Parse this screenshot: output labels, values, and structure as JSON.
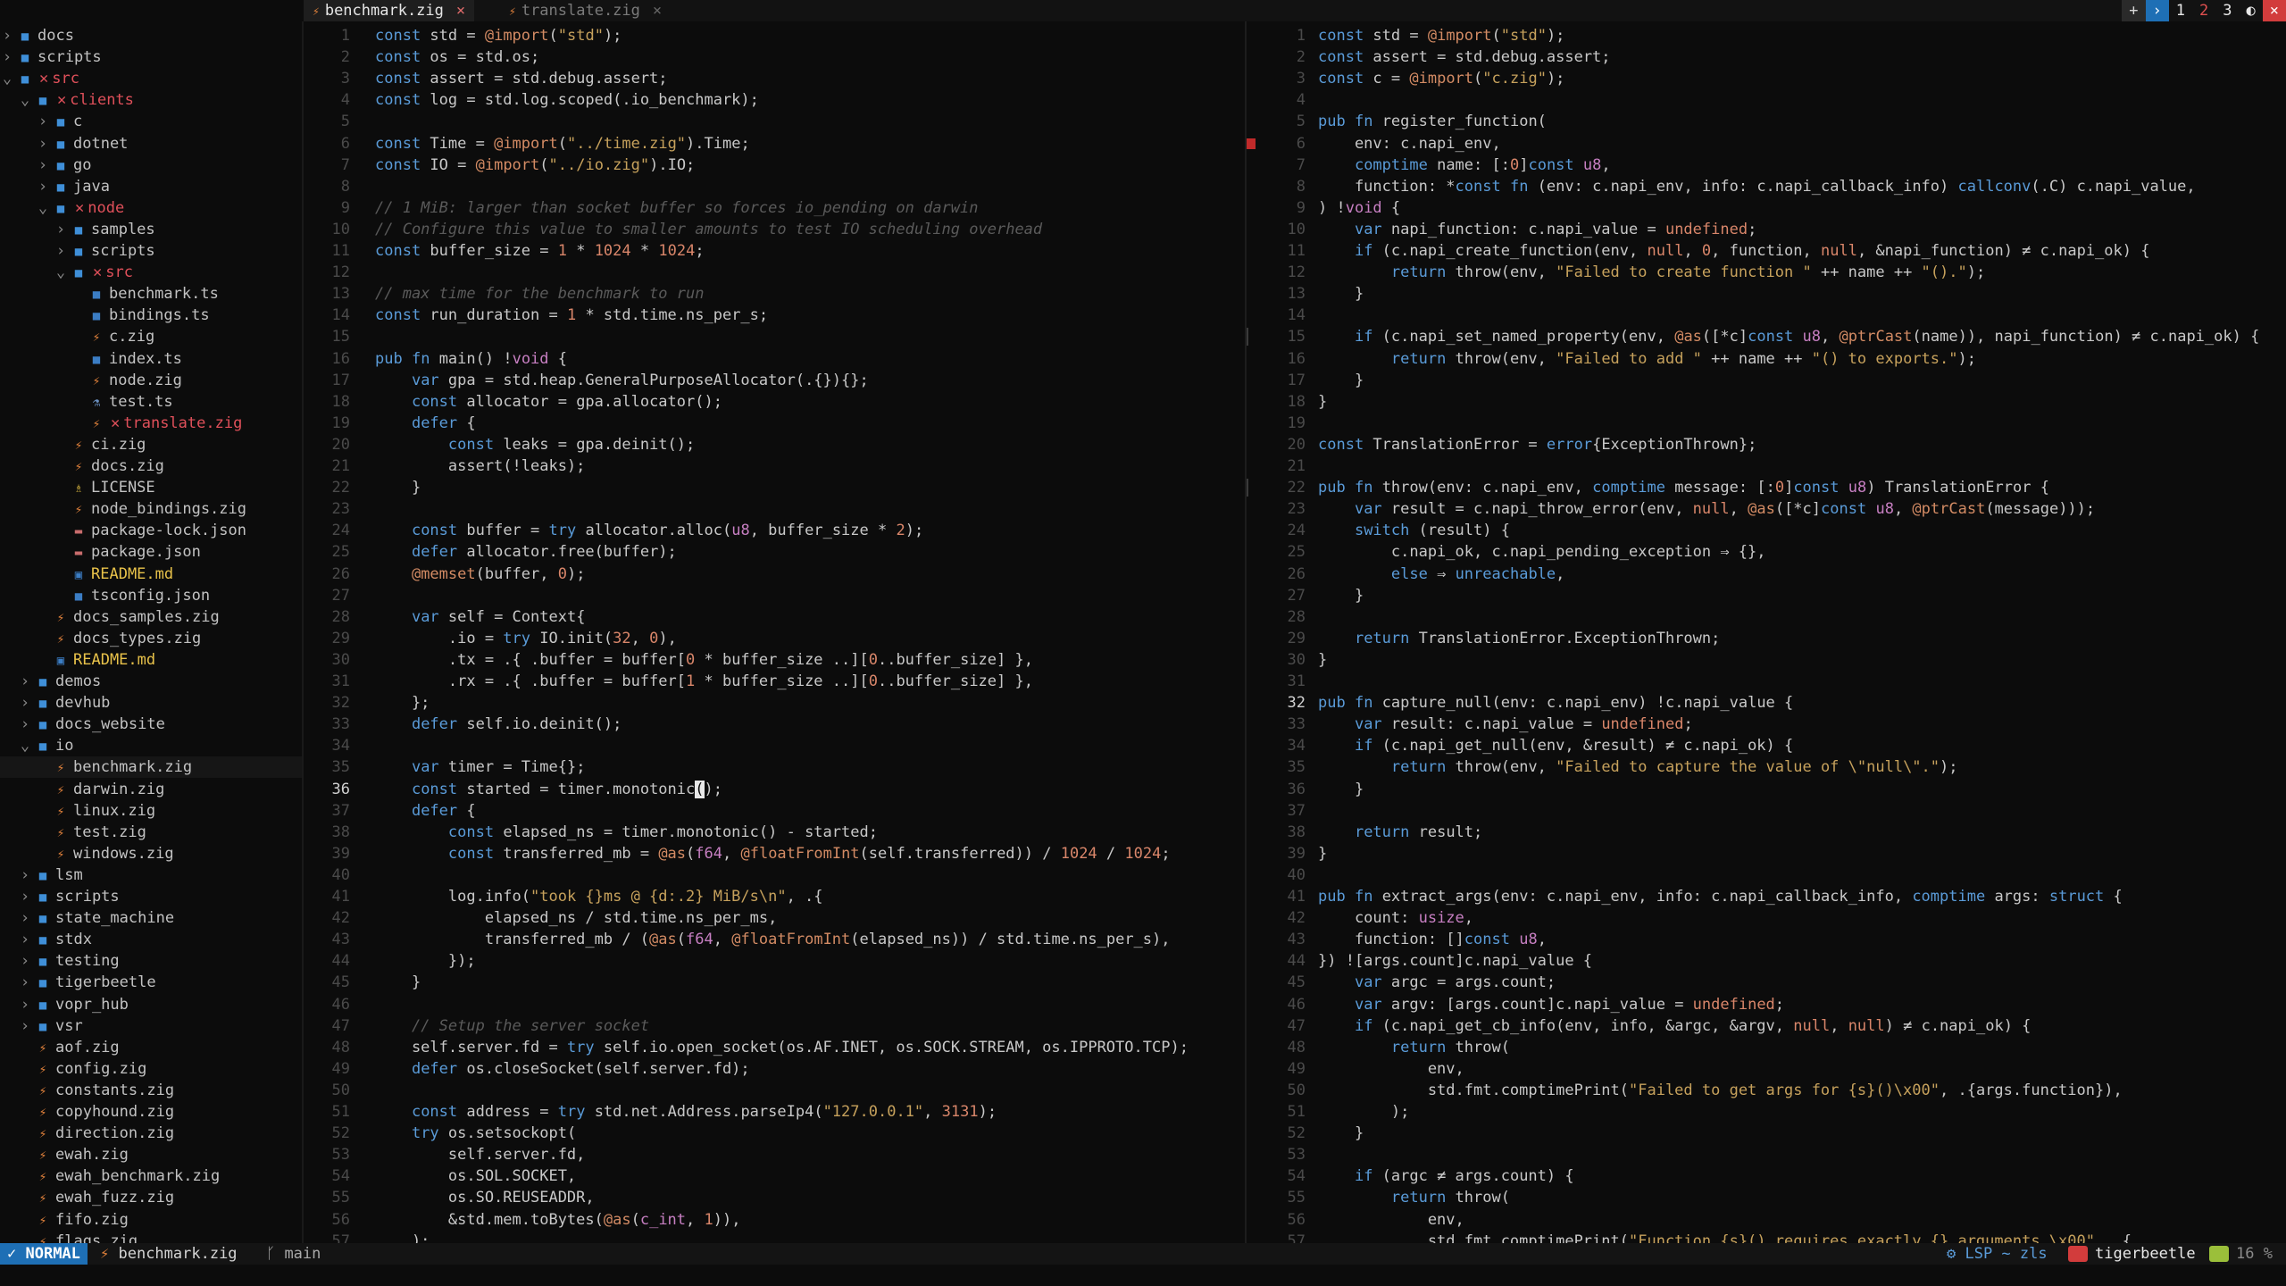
{
  "tabs": [
    {
      "label": "benchmark.zig",
      "active": true,
      "close": "×"
    },
    {
      "label": "translate.zig",
      "active": false,
      "close": "×"
    }
  ],
  "tabbar_right": {
    "plus": "+",
    "arrow": "›",
    "tab1": "1",
    "tab2": "2",
    "tab3": "3",
    "toggle": "◐",
    "close": "×"
  },
  "tree": [
    {
      "name": "docs",
      "type": "folder",
      "depth": 0,
      "chev": "›"
    },
    {
      "name": "scripts",
      "type": "folder",
      "depth": 0,
      "chev": "›"
    },
    {
      "name": "src",
      "type": "folder",
      "depth": 0,
      "chev": "⌄",
      "modified": true
    },
    {
      "name": "clients",
      "type": "folder",
      "depth": 1,
      "chev": "⌄",
      "modified": true
    },
    {
      "name": "c",
      "type": "folder",
      "depth": 2,
      "chev": "›"
    },
    {
      "name": "dotnet",
      "type": "folder",
      "depth": 2,
      "chev": "›"
    },
    {
      "name": "go",
      "type": "folder",
      "depth": 2,
      "chev": "›"
    },
    {
      "name": "java",
      "type": "folder",
      "depth": 2,
      "chev": "›"
    },
    {
      "name": "node",
      "type": "folder",
      "depth": 2,
      "chev": "⌄",
      "modified": true
    },
    {
      "name": "samples",
      "type": "folder",
      "depth": 3,
      "chev": "›"
    },
    {
      "name": "scripts",
      "type": "folder",
      "depth": 3,
      "chev": "›"
    },
    {
      "name": "src",
      "type": "folder",
      "depth": 3,
      "chev": "⌄",
      "modified": true
    },
    {
      "name": "benchmark.ts",
      "type": "ts",
      "depth": 4
    },
    {
      "name": "bindings.ts",
      "type": "ts",
      "depth": 4
    },
    {
      "name": "c.zig",
      "type": "zig",
      "depth": 4
    },
    {
      "name": "index.ts",
      "type": "ts",
      "depth": 4
    },
    {
      "name": "node.zig",
      "type": "zig",
      "depth": 4
    },
    {
      "name": "test.ts",
      "type": "test",
      "depth": 4
    },
    {
      "name": "translate.zig",
      "type": "zig",
      "depth": 4,
      "modified": true
    },
    {
      "name": "ci.zig",
      "type": "zig",
      "depth": 3
    },
    {
      "name": "docs.zig",
      "type": "zig",
      "depth": 3
    },
    {
      "name": "LICENSE",
      "type": "lic",
      "depth": 3
    },
    {
      "name": "node_bindings.zig",
      "type": "zig",
      "depth": 3
    },
    {
      "name": "package-lock.json",
      "type": "json",
      "depth": 3
    },
    {
      "name": "package.json",
      "type": "json",
      "depth": 3
    },
    {
      "name": "README.md",
      "type": "md",
      "depth": 3
    },
    {
      "name": "tsconfig.json",
      "type": "ts",
      "depth": 3
    },
    {
      "name": "docs_samples.zig",
      "type": "zig",
      "depth": 2
    },
    {
      "name": "docs_types.zig",
      "type": "zig",
      "depth": 2
    },
    {
      "name": "README.md",
      "type": "md",
      "depth": 2
    },
    {
      "name": "demos",
      "type": "folder",
      "depth": 1,
      "chev": "›"
    },
    {
      "name": "devhub",
      "type": "folder",
      "depth": 1,
      "chev": "›"
    },
    {
      "name": "docs_website",
      "type": "folder",
      "depth": 1,
      "chev": "›"
    },
    {
      "name": "io",
      "type": "folder",
      "depth": 1,
      "chev": "⌄",
      "open_mod": true
    },
    {
      "name": "benchmark.zig",
      "type": "zig",
      "depth": 2,
      "selected": true
    },
    {
      "name": "darwin.zig",
      "type": "zig",
      "depth": 2
    },
    {
      "name": "linux.zig",
      "type": "zig",
      "depth": 2
    },
    {
      "name": "test.zig",
      "type": "zig",
      "depth": 2
    },
    {
      "name": "windows.zig",
      "type": "zig",
      "depth": 2
    },
    {
      "name": "lsm",
      "type": "folder",
      "depth": 1,
      "chev": "›"
    },
    {
      "name": "scripts",
      "type": "folder",
      "depth": 1,
      "chev": "›"
    },
    {
      "name": "state_machine",
      "type": "folder",
      "depth": 1,
      "chev": "›"
    },
    {
      "name": "stdx",
      "type": "folder",
      "depth": 1,
      "chev": "›"
    },
    {
      "name": "testing",
      "type": "folder",
      "depth": 1,
      "chev": "›"
    },
    {
      "name": "tigerbeetle",
      "type": "folder",
      "depth": 1,
      "chev": "›"
    },
    {
      "name": "vopr_hub",
      "type": "folder",
      "depth": 1,
      "chev": "›"
    },
    {
      "name": "vsr",
      "type": "folder",
      "depth": 1,
      "chev": "›"
    },
    {
      "name": "aof.zig",
      "type": "zig",
      "depth": 1
    },
    {
      "name": "config.zig",
      "type": "zig",
      "depth": 1
    },
    {
      "name": "constants.zig",
      "type": "zig",
      "depth": 1
    },
    {
      "name": "copyhound.zig",
      "type": "zig",
      "depth": 1
    },
    {
      "name": "direction.zig",
      "type": "zig",
      "depth": 1
    },
    {
      "name": "ewah.zig",
      "type": "zig",
      "depth": 1
    },
    {
      "name": "ewah_benchmark.zig",
      "type": "zig",
      "depth": 1
    },
    {
      "name": "ewah_fuzz.zig",
      "type": "zig",
      "depth": 1
    },
    {
      "name": "fifo.zig",
      "type": "zig",
      "depth": 1
    },
    {
      "name": "flags.zig",
      "type": "zig",
      "depth": 1
    }
  ],
  "left_code": {
    "cursor_line": 36,
    "lines": [
      "const std = @import(\"std\");",
      "const os = std.os;",
      "const assert = std.debug.assert;",
      "const log = std.log.scoped(.io_benchmark);",
      "",
      "const Time = @import(\"../time.zig\").Time;",
      "const IO = @import(\"../io.zig\").IO;",
      "",
      "// 1 MiB: larger than socket buffer so forces io_pending on darwin",
      "// Configure this value to smaller amounts to test IO scheduling overhead",
      "const buffer_size = 1 * 1024 * 1024;",
      "",
      "// max time for the benchmark to run",
      "const run_duration = 1 * std.time.ns_per_s;",
      "",
      "pub fn main() !void {",
      "    var gpa = std.heap.GeneralPurposeAllocator(.{}){};",
      "    const allocator = gpa.allocator();",
      "    defer {",
      "        const leaks = gpa.deinit();",
      "        assert(!leaks);",
      "    }",
      "",
      "    const buffer = try allocator.alloc(u8, buffer_size * 2);",
      "    defer allocator.free(buffer);",
      "    @memset(buffer, 0);",
      "",
      "    var self = Context{",
      "        .io = try IO.init(32, 0),",
      "        .tx = .{ .buffer = buffer[0 * buffer_size ..][0..buffer_size] },",
      "        .rx = .{ .buffer = buffer[1 * buffer_size ..][0..buffer_size] },",
      "    };",
      "    defer self.io.deinit();",
      "",
      "    var timer = Time{};",
      "    const started = timer.monotonic();",
      "    defer {",
      "        const elapsed_ns = timer.monotonic() - started;",
      "        const transferred_mb = @as(f64, @floatFromInt(self.transferred)) / 1024 / 1024;",
      "",
      "        log.info(\"took {}ms @ {d:.2} MiB/s\\n\", .{",
      "            elapsed_ns / std.time.ns_per_ms,",
      "            transferred_mb / (@as(f64, @floatFromInt(elapsed_ns)) / std.time.ns_per_s),",
      "        });",
      "    }",
      "",
      "    // Setup the server socket",
      "    self.server.fd = try self.io.open_socket(os.AF.INET, os.SOCK.STREAM, os.IPPROTO.TCP);",
      "    defer os.closeSocket(self.server.fd);",
      "",
      "    const address = try std.net.Address.parseIp4(\"127.0.0.1\", 3131);",
      "    try os.setsockopt(",
      "        self.server.fd,",
      "        os.SOL.SOCKET,",
      "        os.SO.REUSEADDR,",
      "        &std.mem.toBytes(@as(c_int, 1)),",
      "    );"
    ]
  },
  "right_code": {
    "cursor_line": 32,
    "lines": [
      "const std = @import(\"std\");",
      "const assert = std.debug.assert;",
      "const c = @import(\"c.zig\");",
      "",
      "pub fn register_function(",
      "    env: c.napi_env,",
      "    comptime name: [:0]const u8,",
      "    function: *const fn (env: c.napi_env, info: c.napi_callback_info) callconv(.C) c.napi_value,",
      ") !void {",
      "    var napi_function: c.napi_value = undefined;",
      "    if (c.napi_create_function(env, null, 0, function, null, &napi_function) ≠ c.napi_ok) {",
      "        return throw(env, \"Failed to create function \" ++ name ++ \"().\");",
      "    }",
      "",
      "    if (c.napi_set_named_property(env, @as([*c]const u8, @ptrCast(name)), napi_function) ≠ c.napi_ok) {",
      "        return throw(env, \"Failed to add \" ++ name ++ \"() to exports.\");",
      "    }",
      "}",
      "",
      "const TranslationError = error{ExceptionThrown};",
      "",
      "pub fn throw(env: c.napi_env, comptime message: [:0]const u8) TranslationError {",
      "    var result = c.napi_throw_error(env, null, @as([*c]const u8, @ptrCast(message)));",
      "    switch (result) {",
      "        c.napi_ok, c.napi_pending_exception ⇒ {},",
      "        else ⇒ unreachable,",
      "    }",
      "",
      "    return TranslationError.ExceptionThrown;",
      "}",
      "",
      "pub fn capture_null(env: c.napi_env) !c.napi_value {",
      "    var result: c.napi_value = undefined;",
      "    if (c.napi_get_null(env, &result) ≠ c.napi_ok) {",
      "        return throw(env, \"Failed to capture the value of \\\"null\\\".\");",
      "    }",
      "",
      "    return result;",
      "}",
      "",
      "pub fn extract_args(env: c.napi_env, info: c.napi_callback_info, comptime args: struct {",
      "    count: usize,",
      "    function: []const u8,",
      "}) ![args.count]c.napi_value {",
      "    var argc = args.count;",
      "    var argv: [args.count]c.napi_value = undefined;",
      "    if (c.napi_get_cb_info(env, info, &argc, &argv, null, null) ≠ c.napi_ok) {",
      "        return throw(",
      "            env,",
      "            std.fmt.comptimePrint(\"Failed to get args for {s}()\\x00\", .{args.function}),",
      "        );",
      "    }",
      "",
      "    if (argc ≠ args.count) {",
      "        return throw(",
      "            env,",
      "            std.fmt.comptimePrint(\"Function {s}() requires exactly {} arguments.\\x00\", .{"
    ]
  },
  "status": {
    "mode": "NORMAL",
    "file": "benchmark.zig",
    "branch": "main",
    "lsp": "LSP ~ zls",
    "project": "tigerbeetle",
    "percent": "16 %"
  },
  "colors": {
    "accent": "#1e6fb5",
    "zig": "#e0813b",
    "folder": "#3f8fd8",
    "error": "#d23c3c"
  }
}
